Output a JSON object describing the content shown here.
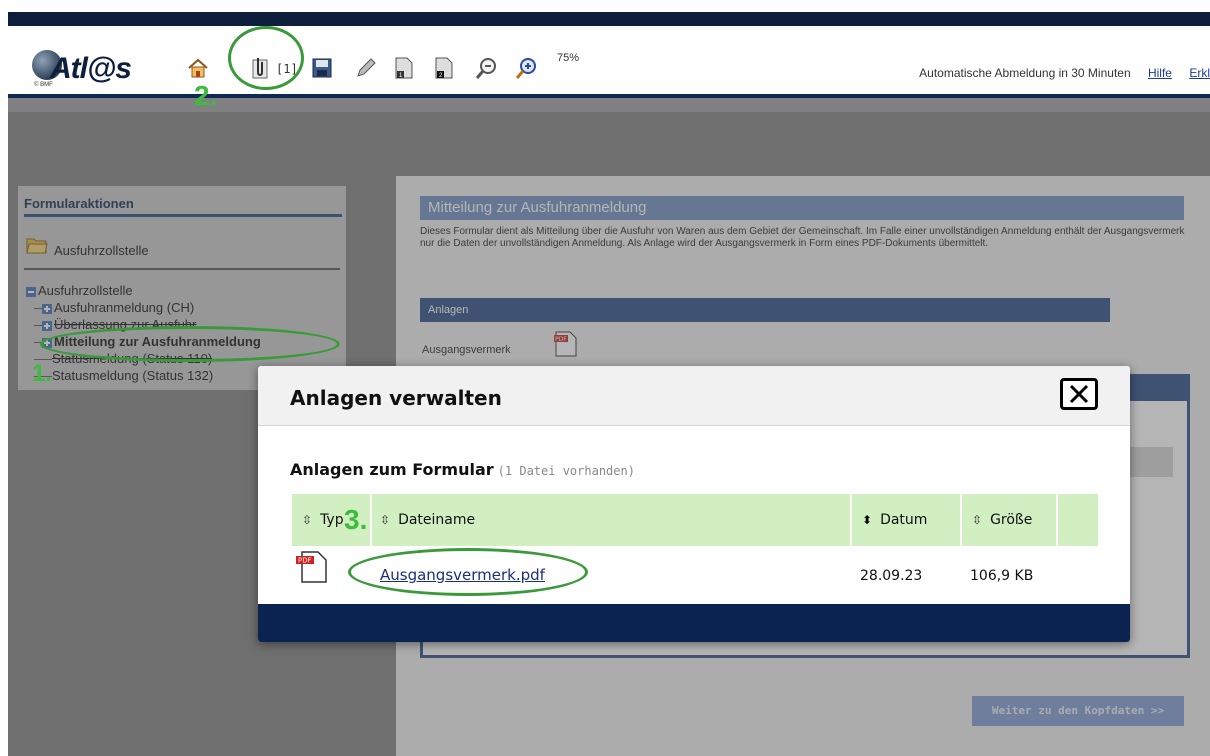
{
  "header": {
    "logo_text": "Atl@s",
    "logo_sub": "© BMF",
    "attachment_count": "[1]",
    "zoom": "75%",
    "logout_text": "Automatische Abmeldung in 30 Minuten",
    "help_link": "Hilfe",
    "explain_link": "Erkl",
    "icons": [
      "home-icon",
      "paperclip-icon",
      "save-icon",
      "pencil-icon",
      "page-1-icon",
      "page-2-icon",
      "zoom-out-icon",
      "zoom-in-icon"
    ]
  },
  "annotations": {
    "one": "1.",
    "two": "2.",
    "three": "3."
  },
  "sidebar": {
    "title": "Formularaktionen",
    "folder_label": "Ausfuhrzollstelle",
    "tree": [
      {
        "label": "Ausfuhrzollstelle",
        "level": 0
      },
      {
        "label": "Ausfuhranmeldung (CH)",
        "level": 1
      },
      {
        "label": "Überlassung zur Ausfuhr",
        "level": 1
      },
      {
        "label": "Mitteilung zur Ausfuhranmeldung",
        "level": 1
      },
      {
        "label": "Statusmeldung (Status 110)",
        "level": 1
      },
      {
        "label": "Statusmeldung (Status 132)",
        "level": 1
      }
    ]
  },
  "main": {
    "title": "Mitteilung zur Ausfuhranmeldung",
    "description": "Dieses Formular dient als Mitteilung über die Ausfuhr von Waren aus dem Gebiet der Gemeinschaft.  Im Falle einer unvollständigen Anmeldung enthält der Ausgangsvermerk nur die Daten der unvollständigen Anmeldung. Als Anlage wird der Ausgangsvermerk in Form eines PDF-Dokuments übermittelt.",
    "anlagen_header": "Anlagen",
    "anlage_label": "Ausgangsvermerk",
    "next_button": "Weiter zu den Kopfdaten >>"
  },
  "modal": {
    "title": "Anlagen verwalten",
    "subtitle": "Anlagen zum Formular",
    "file_count": "(1 Datei vorhanden)",
    "columns": [
      "Typ",
      "Dateiname",
      "Datum",
      "Größe"
    ],
    "rows": [
      {
        "type": "PDF",
        "filename": "Ausgangsvermerk.pdf",
        "date": "28.09.23",
        "size": "106,9 KB"
      }
    ]
  },
  "colors": {
    "accent_navy": "#0b2350",
    "table_header": "#d2efc2",
    "panel_blue": "#2a4c85",
    "annotation_green": "#3cbc3c"
  }
}
